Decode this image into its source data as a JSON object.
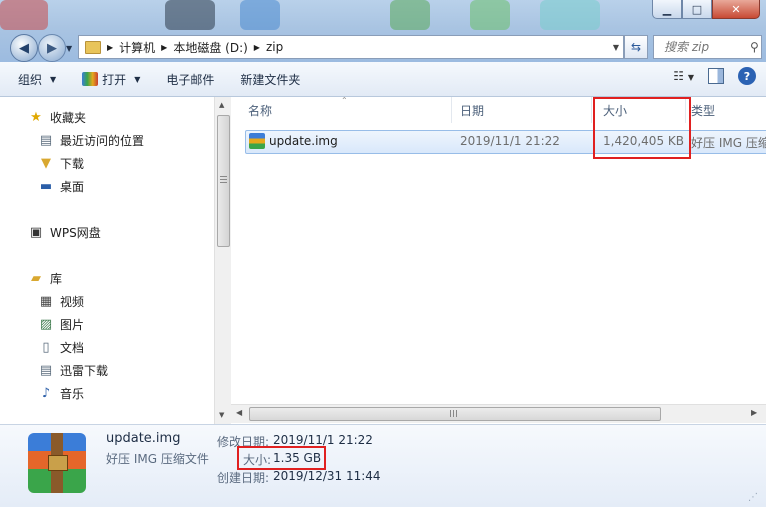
{
  "window": {
    "buttons": {
      "minimize": "▁",
      "maximize": "□",
      "close": "✕"
    }
  },
  "address": {
    "crumbs": [
      "计算机",
      "本地磁盘 (D:)",
      "zip"
    ],
    "search_placeholder": "搜索 zip"
  },
  "toolbar": {
    "organize": "组织",
    "open": "打开",
    "email": "电子邮件",
    "new_folder": "新建文件夹"
  },
  "sidebar": {
    "favorites": "收藏夹",
    "recent": "最近访问的位置",
    "downloads": "下载",
    "desktop": "桌面",
    "wps": "WPS网盘",
    "library": "库",
    "videos": "视频",
    "pictures": "图片",
    "documents": "文档",
    "xunlei": "迅雷下载",
    "music": "音乐"
  },
  "columns": {
    "name": "名称",
    "date": "日期",
    "size": "大小",
    "type": "类型"
  },
  "file": {
    "name": "update.img",
    "date": "2019/11/1 21:22",
    "size": "1,420,405 KB",
    "type": "好压 IMG 压缩文件"
  },
  "details": {
    "filename": "update.img",
    "filetype": "好压 IMG 压缩文件",
    "modified_label": "修改日期:",
    "modified": "2019/11/1 21:22",
    "size_label": "大小:",
    "size": "1.35 GB",
    "created_label": "创建日期:",
    "created": "2019/12/31 11:44"
  },
  "colors": {
    "highlight_box": "#e02020",
    "selection": "#d9e8fb"
  }
}
